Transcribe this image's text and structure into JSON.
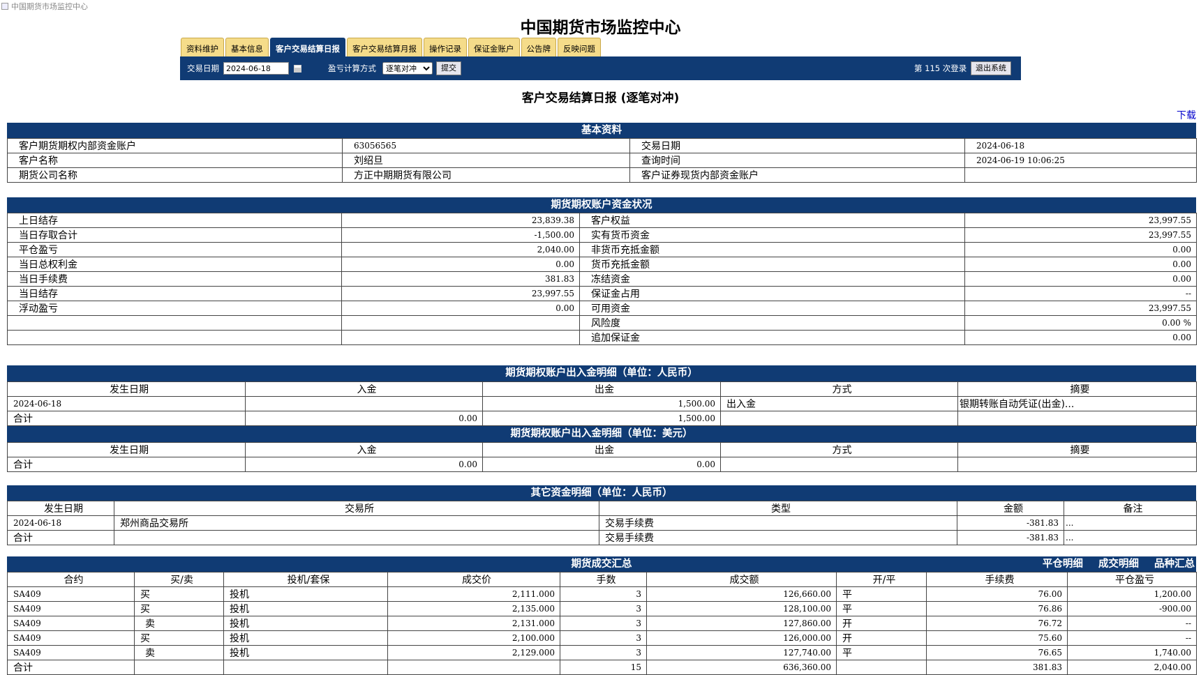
{
  "window": {
    "title": "中国期货市场监控中心"
  },
  "site_title": "中国期货市场监控中心",
  "tabs": [
    {
      "label": "资料维护"
    },
    {
      "label": "基本信息"
    },
    {
      "label": "客户交易结算日报"
    },
    {
      "label": "客户交易结算月报"
    },
    {
      "label": "操作记录"
    },
    {
      "label": "保证金账户"
    },
    {
      "label": "公告牌"
    },
    {
      "label": "反映问题"
    }
  ],
  "toolbar": {
    "date_label": "交易日期",
    "date_value": "2024-06-18",
    "calc_label": "盈亏计算方式",
    "calc_value": "逐笔对冲",
    "submit_label": "提交",
    "login_count": "第 115 次登录",
    "logout_label": "退出系统"
  },
  "page_title": "客户交易结算日报 (逐笔对冲)",
  "download_label": "下载",
  "basic": {
    "title": "基本资料",
    "rows": [
      [
        "客户期货期权内部资金账户",
        "63056565",
        "交易日期",
        "2024-06-18"
      ],
      [
        "客户名称",
        "刘绍旦",
        "查询时间",
        "2024-06-19 10:06:25"
      ],
      [
        "期货公司名称",
        "方正中期期货有限公司",
        "客户证券现货内部资金账户",
        ""
      ]
    ]
  },
  "funds": {
    "title": "期货期权账户资金状况",
    "rows": [
      [
        "上日结存",
        "23,839.38",
        "客户权益",
        "23,997.55"
      ],
      [
        "当日存取合计",
        "-1,500.00",
        "实有货币资金",
        "23,997.55"
      ],
      [
        "平仓盈亏",
        "2,040.00",
        "非货币充抵金额",
        "0.00"
      ],
      [
        "当日总权利金",
        "0.00",
        "货币充抵金额",
        "0.00"
      ],
      [
        "当日手续费",
        "381.83",
        "冻结资金",
        "0.00"
      ],
      [
        "当日结存",
        "23,997.55",
        "保证金占用",
        "--"
      ],
      [
        "浮动盈亏",
        "0.00",
        "可用资金",
        "23,997.55"
      ],
      [
        "",
        "",
        "风险度",
        "0.00 %"
      ],
      [
        "",
        "",
        "追加保证金",
        "0.00"
      ]
    ]
  },
  "inout_cny": {
    "title": "期货期权账户出入金明细（单位：人民币）",
    "headers": [
      "发生日期",
      "入金",
      "出金",
      "方式",
      "摘要"
    ],
    "rows": [
      [
        "2024-06-18",
        "",
        "1,500.00",
        "出入金",
        "银期转账自动凭证(出金)..."
      ],
      [
        "合计",
        "0.00",
        "1,500.00",
        "",
        ""
      ]
    ]
  },
  "inout_usd": {
    "title": "期货期权账户出入金明细（单位：美元）",
    "headers": [
      "发生日期",
      "入金",
      "出金",
      "方式",
      "摘要"
    ],
    "rows": [
      [
        "合计",
        "0.00",
        "0.00",
        "",
        ""
      ]
    ]
  },
  "other": {
    "title": "其它资金明细（单位：人民币）",
    "headers": [
      "发生日期",
      "交易所",
      "类型",
      "金额",
      "备注"
    ],
    "rows": [
      [
        "2024-06-18",
        "郑州商品交易所",
        "交易手续费",
        "-381.83",
        "..."
      ],
      [
        "合计",
        "",
        "交易手续费",
        "-381.83",
        "..."
      ]
    ]
  },
  "trades": {
    "title": "期货成交汇总",
    "links": [
      "平仓明细",
      "成交明细",
      "品种汇总"
    ],
    "headers": [
      "合约",
      "买/卖",
      "投机/套保",
      "成交价",
      "手数",
      "成交额",
      "开/平",
      "手续费",
      "平仓盈亏"
    ],
    "rows": [
      [
        "SA409",
        "买",
        "投机",
        "2,111.000",
        "3",
        "126,660.00",
        "平",
        "76.00",
        "1,200.00"
      ],
      [
        "SA409",
        "买",
        "投机",
        "2,135.000",
        "3",
        "128,100.00",
        "平",
        "76.86",
        "-900.00"
      ],
      [
        "SA409",
        "卖",
        "投机",
        "2,131.000",
        "3",
        "127,860.00",
        "开",
        "76.72",
        "--"
      ],
      [
        "SA409",
        "买",
        "投机",
        "2,100.000",
        "3",
        "126,000.00",
        "开",
        "75.60",
        "--"
      ],
      [
        "SA409",
        "卖",
        "投机",
        "2,129.000",
        "3",
        "127,740.00",
        "平",
        "76.65",
        "1,740.00"
      ],
      [
        "合计",
        "",
        "",
        "",
        "15",
        "636,360.00",
        "",
        "381.83",
        "2,040.00"
      ]
    ]
  }
}
